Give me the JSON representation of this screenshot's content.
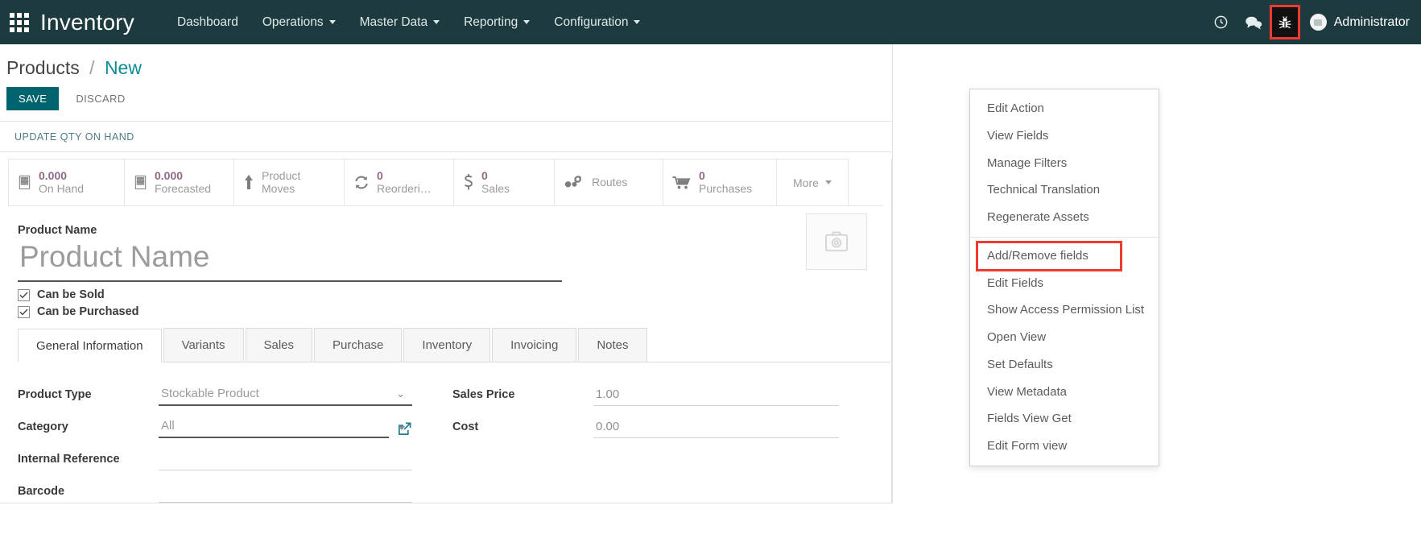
{
  "navbar": {
    "apps_icon": "apps-grid-icon",
    "brand": "Inventory",
    "menus": [
      {
        "label": "Dashboard",
        "has_caret": false
      },
      {
        "label": "Operations",
        "has_caret": true
      },
      {
        "label": "Master Data",
        "has_caret": true
      },
      {
        "label": "Reporting",
        "has_caret": true
      },
      {
        "label": "Configuration",
        "has_caret": true
      }
    ],
    "icons": [
      {
        "name": "clock-icon"
      },
      {
        "name": "chat-bubble-icon"
      },
      {
        "name": "bug-icon",
        "highlighted": true
      }
    ],
    "user": "Administrator",
    "background_color": "#1d3a3f",
    "highlight_color": "#ee3a30"
  },
  "breadcrumb": {
    "root": "Products",
    "separator": "/",
    "current": "New"
  },
  "actions": {
    "save": "SAVE",
    "discard": "DISCARD"
  },
  "statusbar": {
    "update_qty": "UPDATE QTY ON HAND"
  },
  "stat_buttons": [
    {
      "icon": "warehouse-icon",
      "value": "0.000",
      "label": "On Hand"
    },
    {
      "icon": "warehouse-icon",
      "value": "0.000",
      "label": "Forecasted"
    },
    {
      "icon": "arrow-up-icon",
      "value": "",
      "label": "Product Moves"
    },
    {
      "icon": "refresh-icon",
      "value": "0",
      "label": "Reordering Rules"
    },
    {
      "icon": "dollar-icon",
      "value": "0",
      "label": "Sales"
    },
    {
      "icon": "routes-gear-icon",
      "value": "",
      "label": "Routes"
    },
    {
      "icon": "shopping-cart-icon",
      "value": "0",
      "label": "Purchases"
    }
  ],
  "stat_more": "More",
  "product": {
    "name_label": "Product Name",
    "name_value": "",
    "name_placeholder": "Product Name",
    "image_icon": "camera-image-placeholder-icon",
    "can_be_sold": "Can be Sold",
    "can_be_purchased": "Can be Purchased",
    "can_be_sold_checked": true,
    "can_be_purchased_checked": true
  },
  "tabs": [
    {
      "label": "General Information",
      "active": true
    },
    {
      "label": "Variants",
      "active": false
    },
    {
      "label": "Sales",
      "active": false
    },
    {
      "label": "Purchase",
      "active": false
    },
    {
      "label": "Inventory",
      "active": false
    },
    {
      "label": "Invoicing",
      "active": false
    },
    {
      "label": "Notes",
      "active": false
    }
  ],
  "form": {
    "left": [
      {
        "label": "Product Type",
        "value": "Stockable Product",
        "control": "select-chevron"
      },
      {
        "label": "Category",
        "value": "All",
        "control": "select-caret",
        "external_link": true
      },
      {
        "label": "Internal Reference",
        "value": "",
        "control": "text"
      },
      {
        "label": "Barcode",
        "value": "",
        "control": "text"
      }
    ],
    "right": [
      {
        "label": "Sales Price",
        "value": "1.00",
        "control": "text"
      },
      {
        "label": "Cost",
        "value": "0.00",
        "control": "text"
      }
    ]
  },
  "debug_menu": {
    "groups": [
      {
        "items": [
          {
            "label": "Edit Action",
            "highlighted": false
          },
          {
            "label": "View Fields",
            "highlighted": false
          },
          {
            "label": "Manage Filters",
            "highlighted": false
          },
          {
            "label": "Technical Translation",
            "highlighted": false
          },
          {
            "label": "Regenerate Assets",
            "highlighted": false
          }
        ]
      },
      {
        "items": [
          {
            "label": "Add/Remove fields",
            "highlighted": true
          },
          {
            "label": "Edit Fields",
            "highlighted": false
          },
          {
            "label": "Show Access Permission List",
            "highlighted": false
          },
          {
            "label": "Open View",
            "highlighted": false
          },
          {
            "label": "Set Defaults",
            "highlighted": false
          },
          {
            "label": "View Metadata",
            "highlighted": false
          },
          {
            "label": "Fields View Get",
            "highlighted": false
          },
          {
            "label": "Edit Form view",
            "highlighted": false
          }
        ]
      }
    ]
  }
}
